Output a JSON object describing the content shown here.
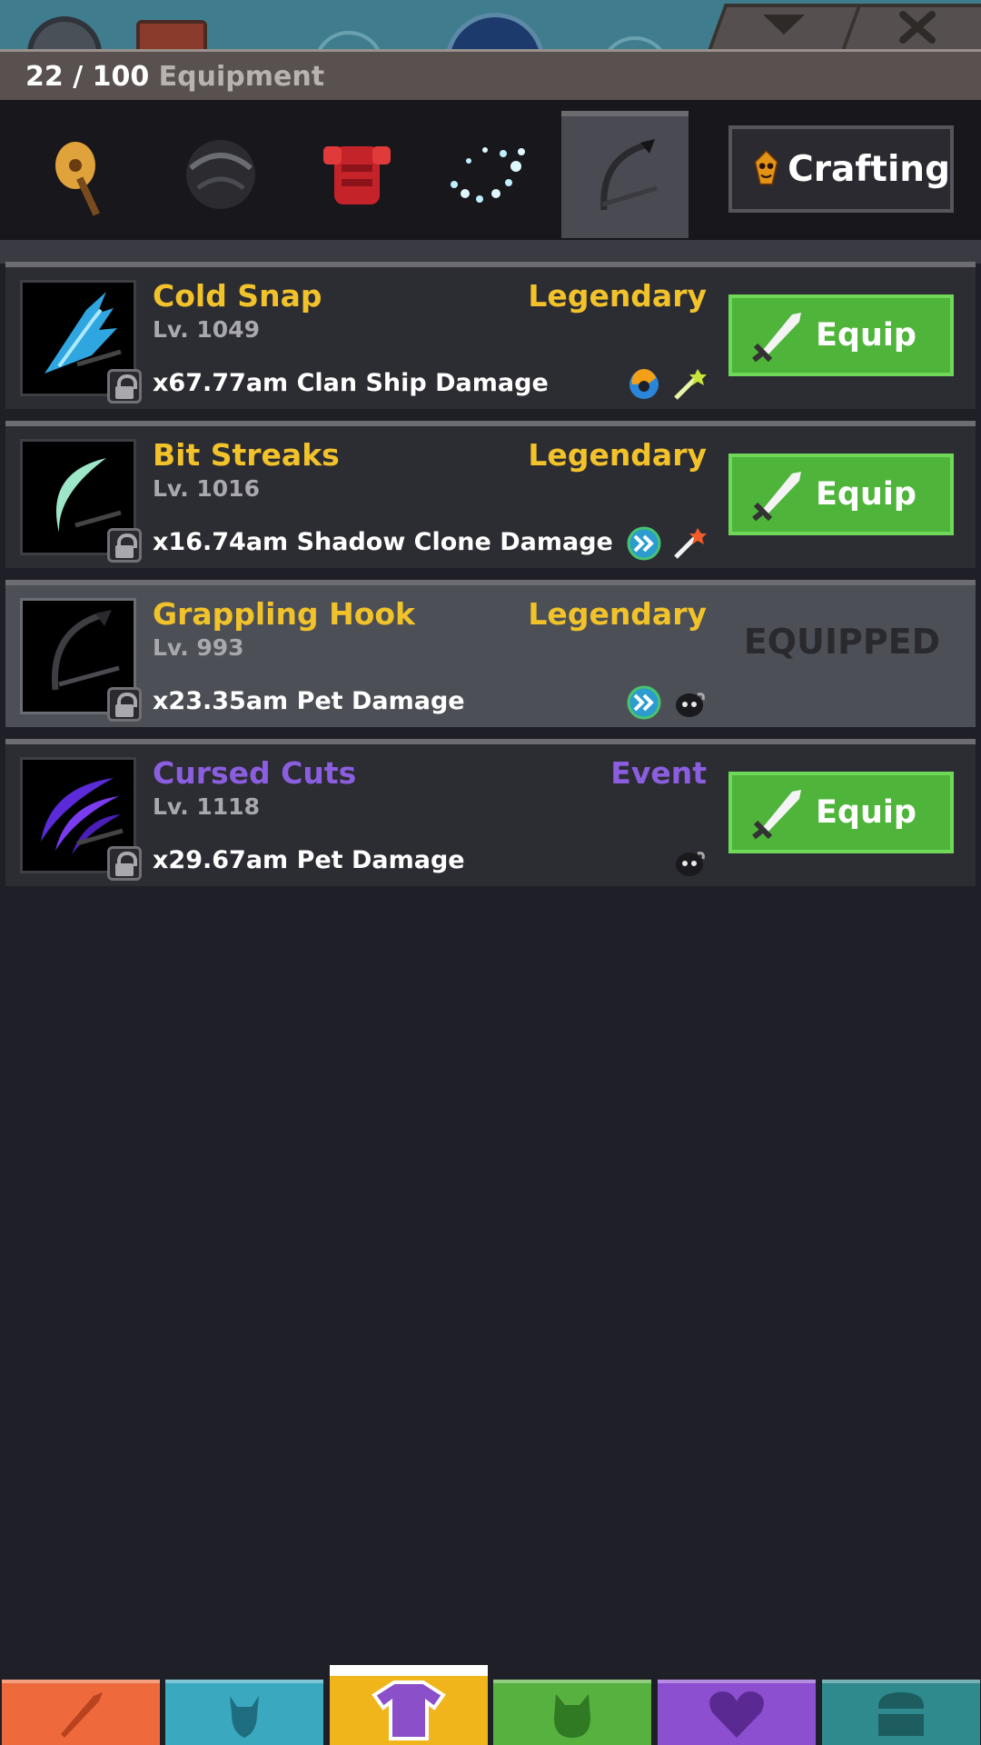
{
  "header": {
    "count": "22 / 100",
    "label": "Equipment"
  },
  "categories": [
    {
      "icon": "guitar-weapon-icon"
    },
    {
      "icon": "hair-helmet-icon"
    },
    {
      "icon": "red-armor-icon"
    },
    {
      "icon": "sparkle-aura-icon"
    },
    {
      "icon": "scythe-slash-icon",
      "selected": true
    }
  ],
  "crafting": {
    "label": "Crafting",
    "icon": "crafting-gem-icon"
  },
  "items": [
    {
      "name": "Cold Snap",
      "rarity": "Legendary",
      "level": "Lv. 1049",
      "bonus": "x67.77am Clan Ship Damage",
      "button": "Equip",
      "icons": [
        "swirl-set-icon",
        "spark-wand-icon"
      ],
      "name_color": "#f2c22b"
    },
    {
      "name": "Bit Streaks",
      "rarity": "Legendary",
      "level": "Lv. 1016",
      "bonus": "x16.74am Shadow Clone Damage",
      "button": "Equip",
      "icons": [
        "double-arrow-set-icon",
        "fire-wand-icon"
      ],
      "name_color": "#f2c22b"
    },
    {
      "name": "Grappling Hook",
      "rarity": "Legendary",
      "level": "Lv. 993",
      "bonus": "x23.35am Pet Damage",
      "status": "EQUIPPED",
      "icons": [
        "double-arrow-set-icon",
        "pet-icon"
      ],
      "name_color": "#f2c22b"
    },
    {
      "name": "Cursed Cuts",
      "rarity": "Event",
      "level": "Lv. 1118",
      "bonus": "x29.67am Pet Damage",
      "button": "Equip",
      "icons": [
        "pet-icon"
      ],
      "name_color": "#8b5ee0"
    }
  ],
  "bottom_nav": [
    {
      "icon": "sword-tab-icon",
      "color": "#ee6a3c"
    },
    {
      "icon": "hero-tab-icon",
      "color": "#3aa8bf"
    },
    {
      "icon": "shirt-tab-icon",
      "color": "#f0b51b",
      "active": true
    },
    {
      "icon": "pet-tab-icon",
      "color": "#57b13e"
    },
    {
      "icon": "heart-tab-icon",
      "color": "#8c4fcf"
    },
    {
      "icon": "chest-tab-icon",
      "color": "#2f8a8e"
    }
  ]
}
